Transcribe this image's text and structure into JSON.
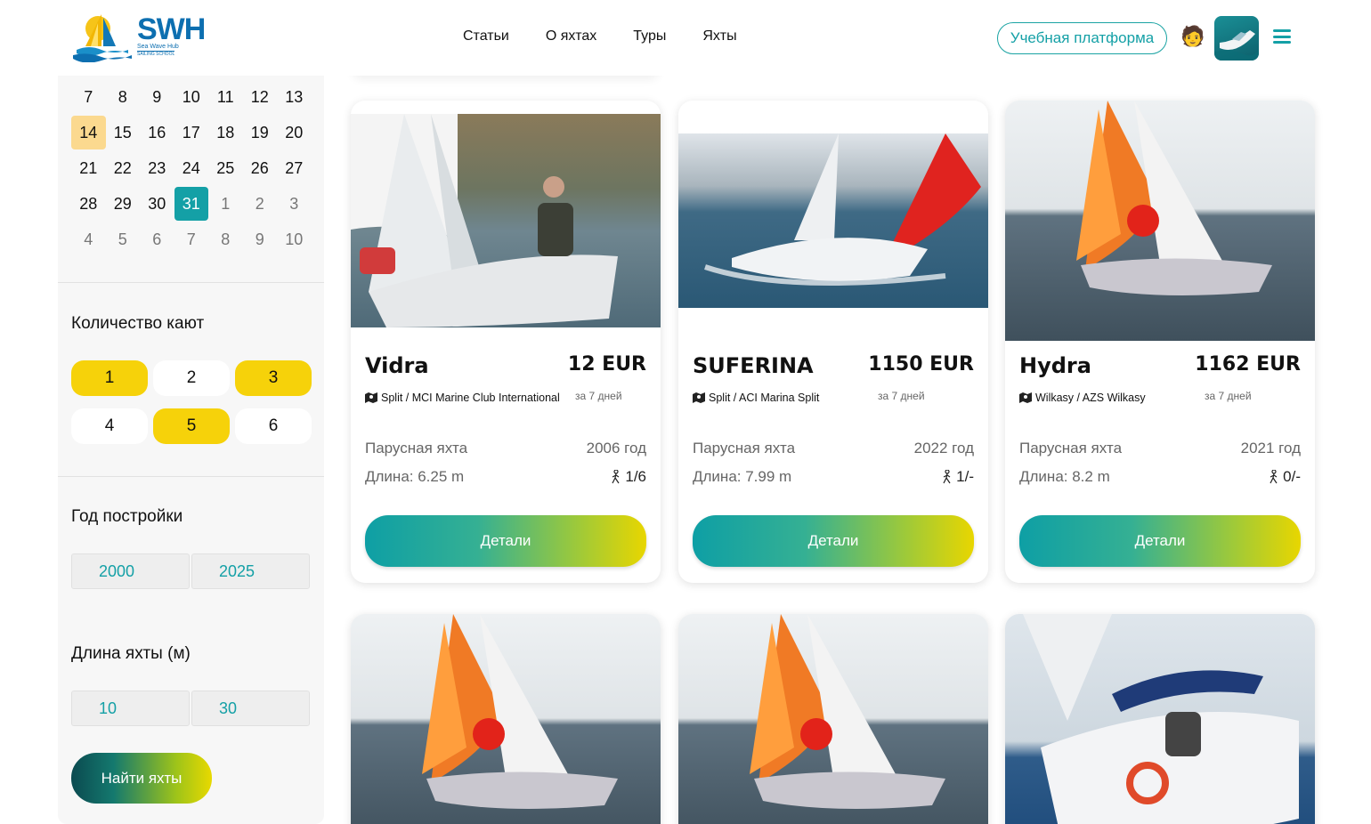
{
  "header": {
    "logo_text": "SWH",
    "logo_sub": "Sea Wave Hub",
    "logo_sub2": "SAILING SCHOOL",
    "nav": [
      "Статьи",
      "О яхтах",
      "Туры",
      "Яхты"
    ],
    "learn_button": "Учебная платформа",
    "icons": [
      "person-icon",
      "boat-avatar",
      "hamburger-menu-icon"
    ]
  },
  "sidebar": {
    "calendar": {
      "rows": [
        [
          "7",
          "8",
          "9",
          "10",
          "11",
          "12",
          "13"
        ],
        [
          "14",
          "15",
          "16",
          "17",
          "18",
          "19",
          "20"
        ],
        [
          "21",
          "22",
          "23",
          "24",
          "25",
          "26",
          "27"
        ],
        [
          "28",
          "29",
          "30",
          "31",
          "1",
          "2",
          "3"
        ],
        [
          "4",
          "5",
          "6",
          "7",
          "8",
          "9",
          "10"
        ]
      ],
      "today": "14",
      "selected": "31"
    },
    "cabins_title": "Количество кают",
    "cabins": [
      {
        "label": "1",
        "on": true
      },
      {
        "label": "2",
        "on": false
      },
      {
        "label": "3",
        "on": true
      },
      {
        "label": "4",
        "on": false
      },
      {
        "label": "5",
        "on": true
      },
      {
        "label": "6",
        "on": false
      }
    ],
    "year_title": "Год постройки",
    "year_from": "2000",
    "year_to": "2025",
    "length_title": "Длина яхты (м)",
    "length_from": "10",
    "length_to": "30",
    "find_button": "Найти яхты"
  },
  "cards": [
    {
      "name": "Vidra",
      "price": "12 EUR",
      "period": "за 7 дней",
      "location": "Split / MCI Marine Club International",
      "type": "Парусная яхта",
      "year": "2006 год",
      "length": "Длина: 6.25 m",
      "berths": "1/6",
      "button": "Детали"
    },
    {
      "name": "SUFERINA",
      "price": "1150 EUR",
      "period": "за 7 дней",
      "location": "Split / ACI Marina Split",
      "type": "Парусная яхта",
      "year": "2022 год",
      "length": "Длина: 7.99 m",
      "berths": "1/-",
      "button": "Детали"
    },
    {
      "name": "Hydra",
      "price": "1162 EUR",
      "period": "за 7 дней",
      "location": "Wilkasy / AZS Wilkasy",
      "type": "Парусная яхта",
      "year": "2021 год",
      "length": "Длина: 8.2 m",
      "berths": "0/-",
      "button": "Детали"
    }
  ],
  "colors": {
    "accent": "#14a0a6",
    "yellow": "#f6d20a",
    "today": "#fbd98f"
  }
}
